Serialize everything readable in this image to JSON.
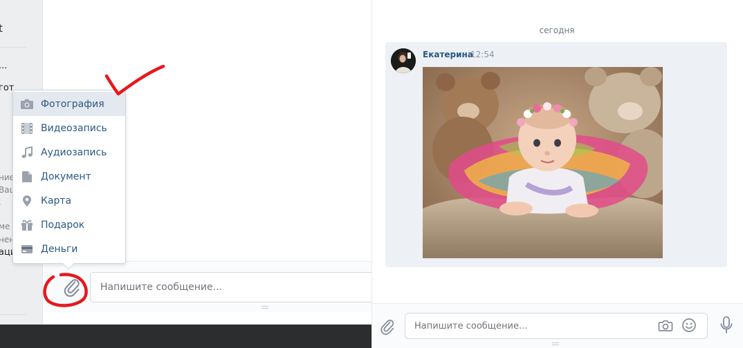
{
  "left_sidebar": {
    "fragments": [
      "t",
      "...",
      "гот",
      "ние",
      "Ваш",
      ".",
      "ме",
      "нени",
      "ацит"
    ]
  },
  "left_composer": {
    "placeholder": "Напишите сообщение..."
  },
  "attach_menu": {
    "items": [
      {
        "label": "Фотография",
        "icon": "camera-icon",
        "active": true
      },
      {
        "label": "Видеозапись",
        "icon": "film-icon",
        "active": false
      },
      {
        "label": "Аудиозапись",
        "icon": "music-note-icon",
        "active": false
      },
      {
        "label": "Документ",
        "icon": "document-icon",
        "active": false
      },
      {
        "label": "Карта",
        "icon": "map-pin-icon",
        "active": false
      },
      {
        "label": "Подарок",
        "icon": "gift-icon",
        "active": false
      },
      {
        "label": "Деньги",
        "icon": "card-icon",
        "active": false
      }
    ]
  },
  "conversation": {
    "date_separator": "сегодня",
    "message": {
      "author": "Екатерина",
      "time": "12:54",
      "attachment": "photo"
    }
  },
  "right_composer": {
    "placeholder": "Напишите сообщение..."
  },
  "colors": {
    "link": "#2a5885",
    "icon": "#828a99",
    "menu_icon": "#99a2ad",
    "active_row": "#e4e9ef",
    "annotation_red": "#e8171c",
    "message_bg": "#edf0f5"
  }
}
